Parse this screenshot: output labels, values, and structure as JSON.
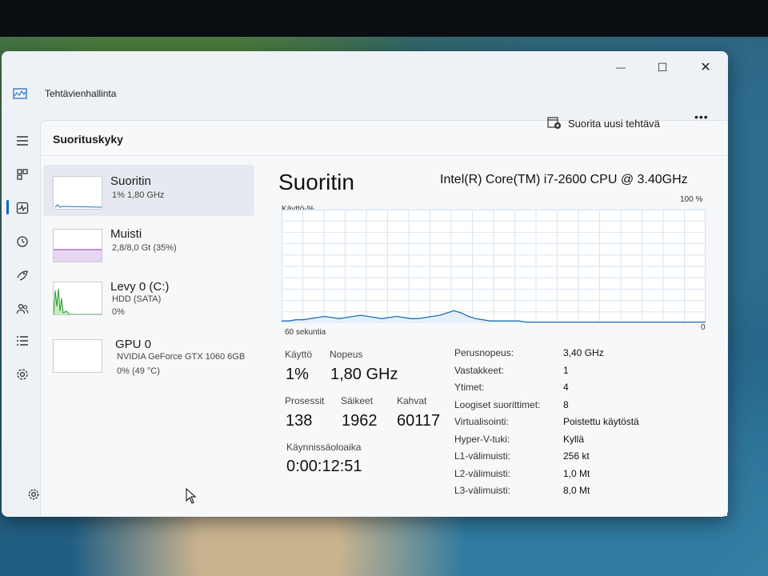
{
  "app": {
    "title": "Tehtävienhallinta"
  },
  "page": {
    "title": "Suorituskyky"
  },
  "toolbar": {
    "run_task_label": "Suorita uusi tehtävä",
    "more_label": "•••"
  },
  "window_controls": {
    "minimize": "—",
    "maximize": "☐",
    "close": "✕"
  },
  "nav": {
    "icons": [
      "menu-icon",
      "processes-icon",
      "performance-icon",
      "history-icon",
      "startup-icon",
      "users-icon",
      "details-icon",
      "services-icon",
      "settings-icon"
    ]
  },
  "devices": [
    {
      "name": "Suoritin",
      "sub1": "1% 1,80 GHz"
    },
    {
      "name": "Muisti",
      "sub1": "2,8/8,0 Gt (35%)"
    },
    {
      "name": "Levy 0 (C:)",
      "sub1": "HDD (SATA)",
      "sub2": "0%"
    },
    {
      "name": "GPU 0",
      "sub1": "NVIDIA GeForce GTX 1060 6GB",
      "sub2": "0% (49 °C)"
    }
  ],
  "detail": {
    "heading": "Suoritin",
    "model": "Intel(R) Core(TM) i7-2600 CPU @ 3.40GHz",
    "graph_label": "Käyttö-%",
    "graph_max": "100 %",
    "graph_time": "60 sekuntia",
    "graph_min": "0",
    "usage_series": [
      2,
      2,
      3,
      3,
      4,
      5,
      6,
      5,
      4,
      5,
      6,
      7,
      6,
      5,
      4,
      5,
      6,
      5,
      4,
      4,
      5,
      6,
      7,
      9,
      11,
      9,
      6,
      4,
      3,
      2,
      2,
      2,
      2,
      2,
      1,
      1,
      1,
      1,
      1,
      1,
      1,
      1,
      1,
      1,
      1,
      1,
      1,
      1,
      1,
      1,
      1,
      1,
      1,
      1,
      1,
      1,
      1,
      1,
      1,
      1
    ],
    "stats": {
      "usage_label": "Käyttö",
      "usage_value": "1%",
      "speed_label": "Nopeus",
      "speed_value": "1,80 GHz",
      "processes_label": "Prosessit",
      "processes_value": "138",
      "threads_label": "Säikeet",
      "threads_value": "1962",
      "handles_label": "Kahvat",
      "handles_value": "60117",
      "uptime_label": "Käynnissäoloaika",
      "uptime_value": "0:00:12:51"
    },
    "specs": [
      {
        "label": "Perusnopeus:",
        "value": "3,40 GHz"
      },
      {
        "label": "Vastakkeet:",
        "value": "1"
      },
      {
        "label": "Ytimet:",
        "value": "4"
      },
      {
        "label": "Loogiset suorittimet:",
        "value": "8"
      },
      {
        "label": "Virtualisointi:",
        "value": "Poistettu käytöstä"
      },
      {
        "label": "Hyper-V-tuki:",
        "value": "Kyllä"
      },
      {
        "label": "L1-välimuisti:",
        "value": "256 kt"
      },
      {
        "label": "L2-välimuisti:",
        "value": "1,0 Mt"
      },
      {
        "label": "L3-välimuisti:",
        "value": "8,0 Mt"
      }
    ]
  },
  "colors": {
    "accent": "#0067c0",
    "graph_line": "#1d6fb8",
    "grid": "#d7e6f2"
  }
}
